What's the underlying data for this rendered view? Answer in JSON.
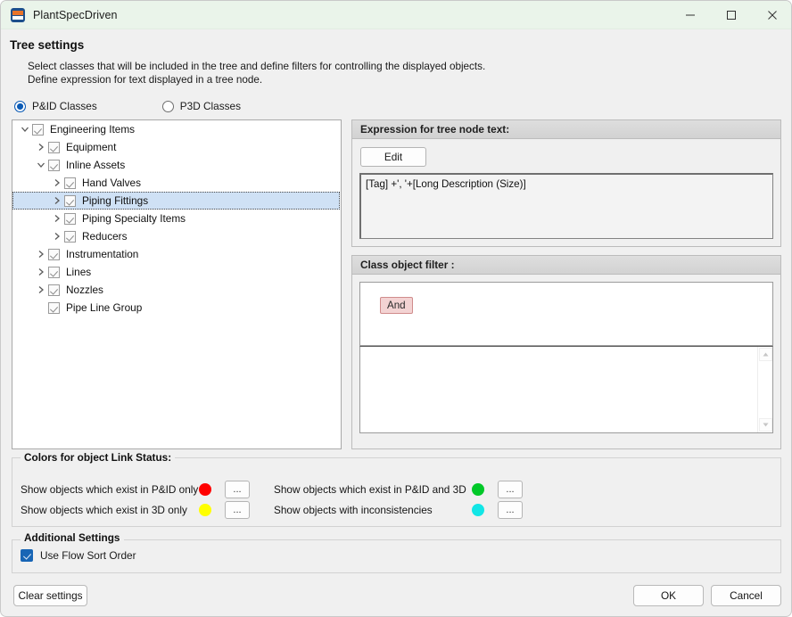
{
  "window": {
    "title": "PlantSpecDriven",
    "icon": "plant-app-icon",
    "controls": [
      {
        "name": "minimize",
        "glyph": "minimize-icon"
      },
      {
        "name": "maximize",
        "glyph": "maximize-icon"
      },
      {
        "name": "close",
        "glyph": "close-icon"
      }
    ]
  },
  "page": {
    "heading": "Tree settings",
    "description_line1": "Select classes that will be included in the tree and define filters for controlling the displayed objects.",
    "description_line2": "Define expression for text displayed in a tree node."
  },
  "class_mode": {
    "options": [
      {
        "label": "P&ID Classes",
        "selected": true
      },
      {
        "label": "P3D Classes",
        "selected": false
      }
    ]
  },
  "tree": {
    "nodes": [
      {
        "label": "Engineering Items",
        "depth": 0,
        "expander": "expanded",
        "checked": true,
        "selected": false
      },
      {
        "label": "Equipment",
        "depth": 1,
        "expander": "collapsed",
        "checked": true,
        "selected": false
      },
      {
        "label": "Inline Assets",
        "depth": 1,
        "expander": "expanded",
        "checked": true,
        "selected": false
      },
      {
        "label": "Hand Valves",
        "depth": 2,
        "expander": "collapsed",
        "checked": true,
        "selected": false
      },
      {
        "label": "Piping Fittings",
        "depth": 2,
        "expander": "collapsed",
        "checked": true,
        "selected": true
      },
      {
        "label": "Piping Specialty Items",
        "depth": 2,
        "expander": "collapsed",
        "checked": true,
        "selected": false
      },
      {
        "label": "Reducers",
        "depth": 2,
        "expander": "collapsed",
        "checked": true,
        "selected": false
      },
      {
        "label": "Instrumentation",
        "depth": 1,
        "expander": "collapsed",
        "checked": true,
        "selected": false
      },
      {
        "label": "Lines",
        "depth": 1,
        "expander": "collapsed",
        "checked": true,
        "selected": false
      },
      {
        "label": "Nozzles",
        "depth": 1,
        "expander": "collapsed",
        "checked": true,
        "selected": false
      },
      {
        "label": "Pipe Line Group",
        "depth": 1,
        "expander": "none",
        "checked": true,
        "selected": false
      }
    ]
  },
  "expression_panel": {
    "title": "Expression for tree node text:",
    "edit_label": "Edit",
    "expression": "[Tag] +', '+[Long Description (Size)]"
  },
  "filter_panel": {
    "title": "Class object filter :",
    "root_operator": "And",
    "operator_color": "#f3d3d3",
    "operator_border": "#d08c8c",
    "scroll_up_icon": "scroll-up-icon",
    "scroll_down_icon": "scroll-down-icon"
  },
  "colors_group": {
    "legend": "Colors for object Link Status:",
    "ellipsis_label": "...",
    "rows": [
      {
        "label": "Show objects which exist in P&ID only",
        "color": "#ff0000"
      },
      {
        "label": "Show objects which exist in 3D only",
        "color": "#ffff00"
      },
      {
        "label": "Show objects which exist in P&ID and 3D",
        "color": "#00c828"
      },
      {
        "label": "Show objects with inconsistencies",
        "color": "#12e6e6"
      }
    ]
  },
  "additional_settings": {
    "legend": "Additional Settings",
    "flow_sort_label": "Use Flow Sort Order",
    "flow_sort_checked": true,
    "checkbox_color": "#1765b5"
  },
  "footer": {
    "clear_label": "Clear settings",
    "ok_label": "OK",
    "cancel_label": "Cancel"
  }
}
